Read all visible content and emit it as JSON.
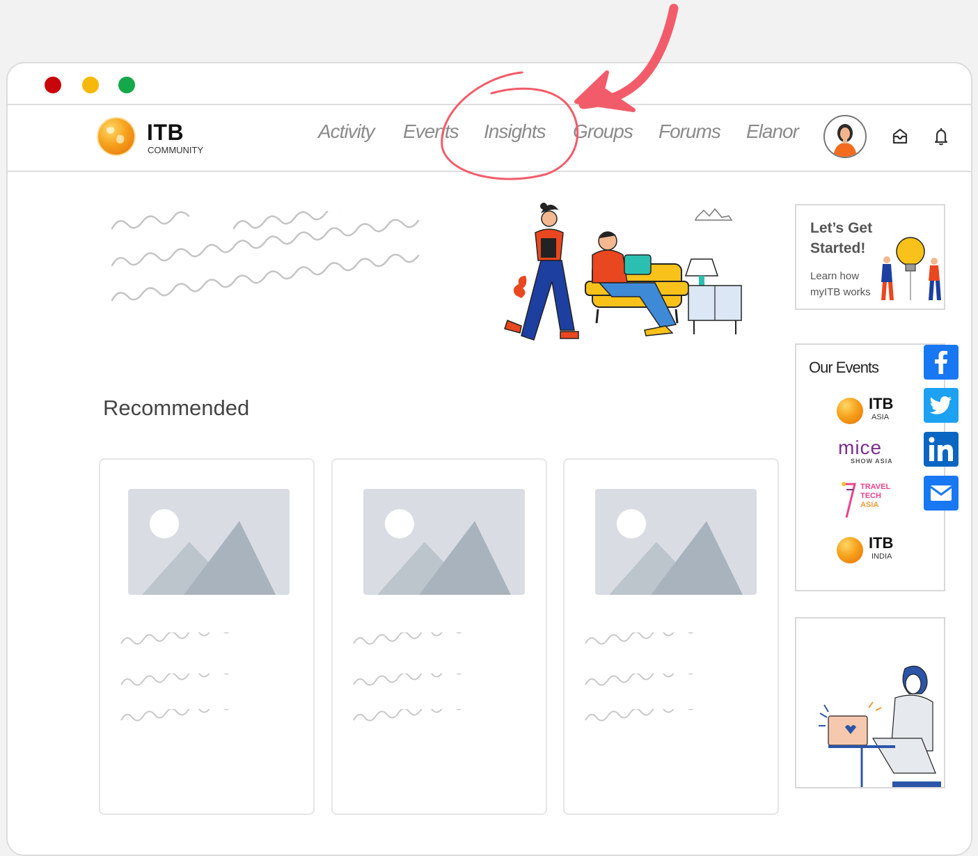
{
  "brand": {
    "name": "ITB",
    "subtitle": "COMMUNITY"
  },
  "nav": {
    "items": [
      {
        "label": "Activity"
      },
      {
        "label": "Events"
      },
      {
        "label": "Insights"
      },
      {
        "label": "Groups"
      },
      {
        "label": "Forums"
      },
      {
        "label": "Elanor"
      }
    ],
    "highlighted": "Insights"
  },
  "window_controls": {
    "close_color": "#c8050b",
    "minimize_color": "#f7b80c",
    "maximize_color": "#15a84a"
  },
  "main": {
    "recommended_title": "Recommended",
    "card_count": 3
  },
  "sidebar": {
    "get_started": {
      "title_line1": "Let’s Get",
      "title_line2": "Started!",
      "sub_line1": "Learn how",
      "sub_line2": "myITB works"
    },
    "our_events": {
      "title": "Our Events",
      "events": [
        {
          "main": "ITB",
          "sub": "ASIA"
        },
        {
          "main": "mice",
          "sub": "SHOW ASIA"
        },
        {
          "line1": "TRAVEL",
          "line2": "TECH",
          "line3": "ASIA"
        },
        {
          "main": "ITB",
          "sub": "INDIA"
        }
      ]
    }
  },
  "social": [
    {
      "name": "facebook",
      "color": "#1877f2"
    },
    {
      "name": "twitter",
      "color": "#1da1f2"
    },
    {
      "name": "linkedin",
      "color": "#0a66c2"
    },
    {
      "name": "email",
      "color": "#1877f2"
    }
  ],
  "annotation": {
    "arrow_color": "#f25c6a"
  }
}
